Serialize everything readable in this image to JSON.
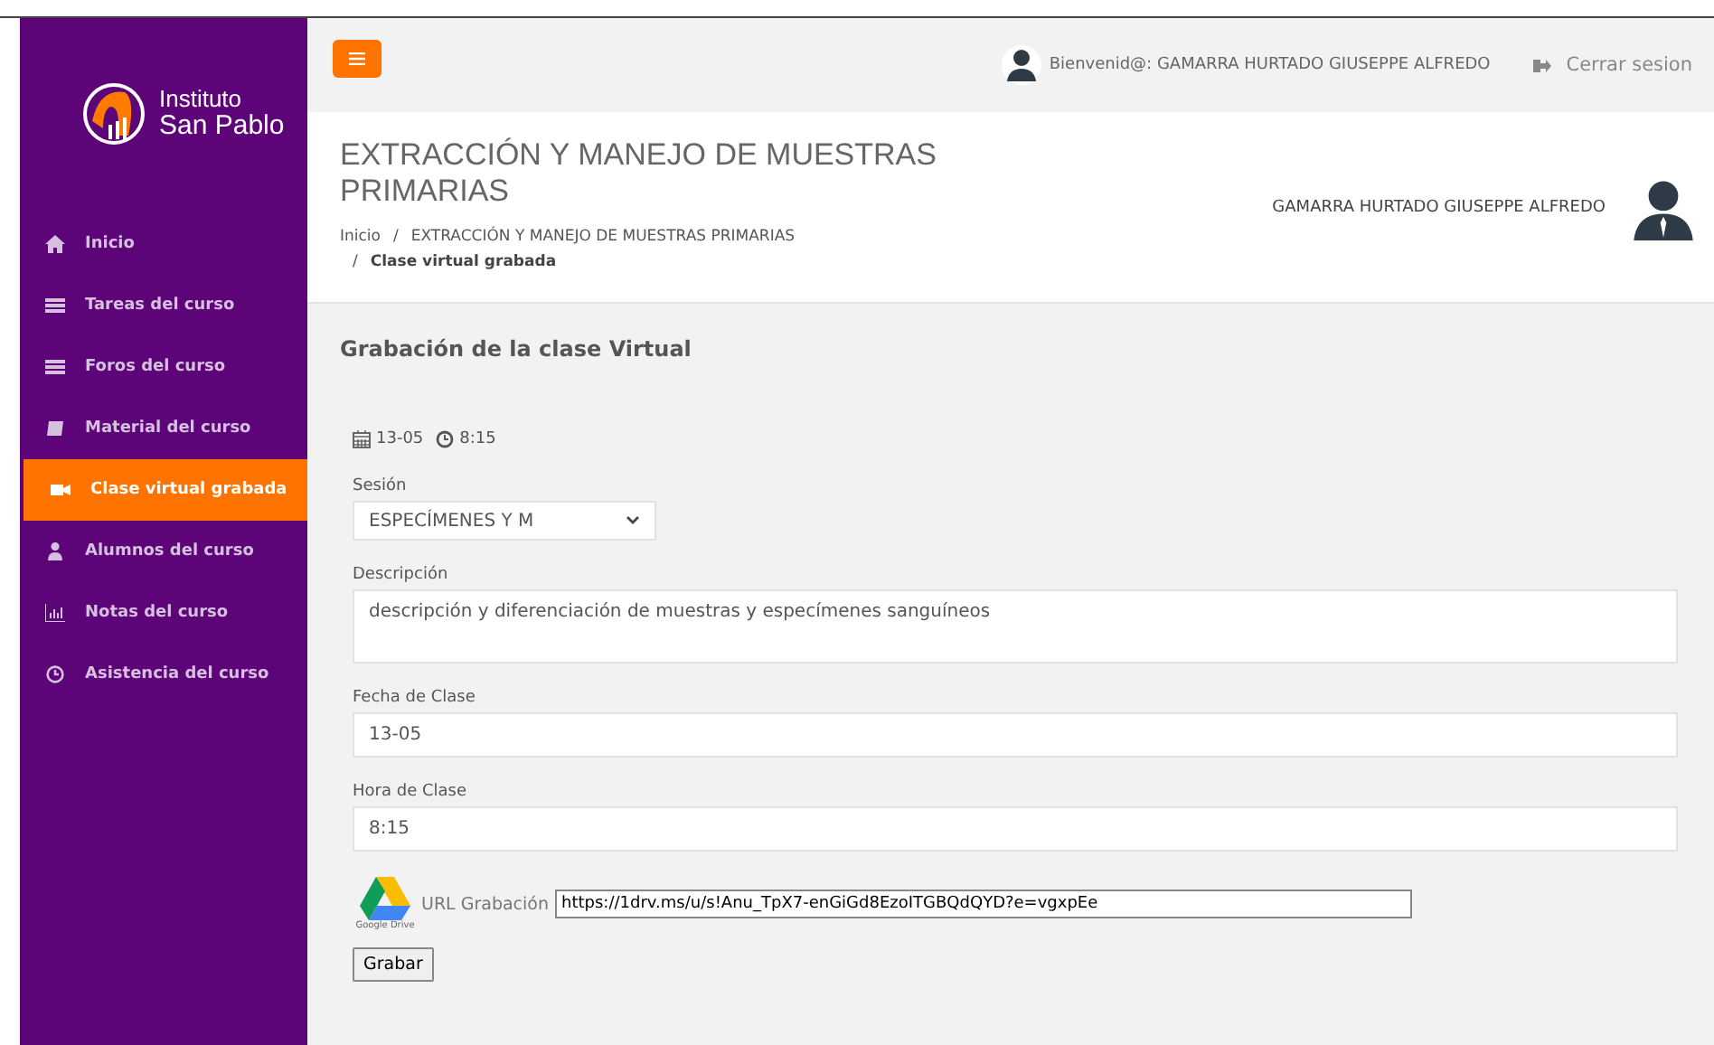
{
  "brand": {
    "line1": "Instituto",
    "line2": "San Pablo"
  },
  "sidebar": {
    "items": [
      {
        "label": "Inicio",
        "kind": "home",
        "selected": false
      },
      {
        "label": "Tareas del curso",
        "kind": "list",
        "selected": false
      },
      {
        "label": "Foros del curso",
        "kind": "list",
        "selected": false
      },
      {
        "label": "Material del curso",
        "kind": "book",
        "selected": false
      },
      {
        "label": "Clase virtual grabada",
        "kind": "video",
        "selected": true
      },
      {
        "label": "Alumnos del curso",
        "kind": "user",
        "selected": false
      },
      {
        "label": "Notas del curso",
        "kind": "chart",
        "selected": false
      },
      {
        "label": "Asistencia del curso",
        "kind": "clock",
        "selected": false
      }
    ]
  },
  "topbar": {
    "welcome": "Bienvenid@: GAMARRA HURTADO GIUSEPPE ALFREDO",
    "logout": "Cerrar sesion"
  },
  "header": {
    "title": "EXTRACCIÓN Y MANEJO DE MUESTRAS PRIMARIAS",
    "breadcrumb": [
      {
        "label": "Inicio"
      },
      {
        "separator": "/",
        "label": "EXTRACCIÓN Y MANEJO DE MUESTRAS PRIMARIAS"
      },
      {
        "separator": "/",
        "label": "Clase virtual grabada"
      }
    ],
    "user": "GAMARRA HURTADO GIUSEPPE ALFREDO"
  },
  "content": {
    "heading": "Grabación de la clase Virtual",
    "date": "13-05",
    "time": "8:15",
    "session_label": "Sesión",
    "session_value": "ESPECÍMENES Y M",
    "description_label": "Descripción",
    "description_value": "descripción y diferenciación de muestras y especímenes sanguíneos",
    "date_label": "Fecha de Clase",
    "date_value": "13-05",
    "time_label": "Hora de Clase",
    "time_value": "8:15",
    "drive_caption": "Google Drive",
    "url_label": "URL Grabación",
    "url_value": "https://1drv.ms/u/s!Anu_TpX7-enGiGd8EzoITGBQdQYD?e=vgxpEe",
    "submit": "Grabar"
  }
}
